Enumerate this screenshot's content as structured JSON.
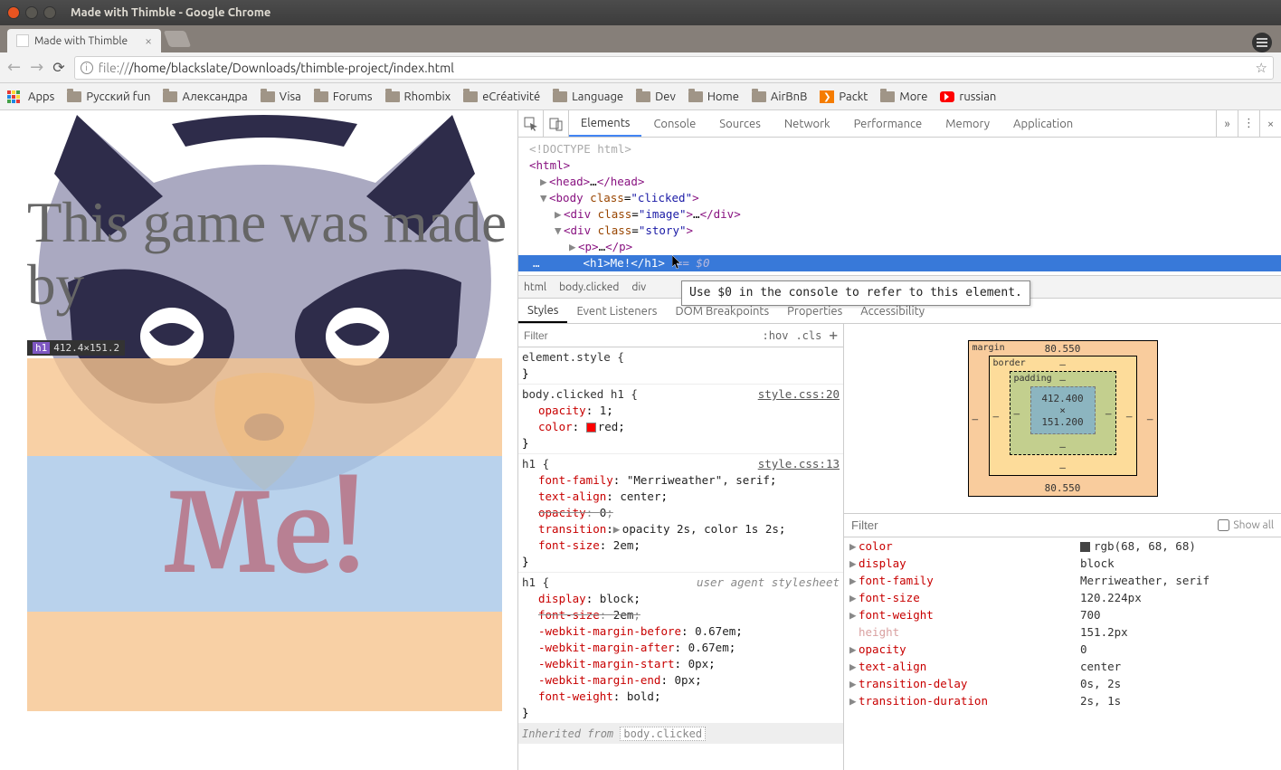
{
  "window": {
    "title": "Made with Thimble - Google Chrome"
  },
  "tab": {
    "title": "Made with Thimble"
  },
  "url": {
    "protocol": "file://",
    "path": "/home/blackslate/Downloads/thimble-project/index.html"
  },
  "bookmarks": {
    "apps": "Apps",
    "items": [
      "Русский fun",
      "Александра",
      "Visa",
      "Forums",
      "Rhombix",
      "eCréativité",
      "Language",
      "Dev",
      "Home",
      "AirBnB"
    ],
    "packt": "Packt",
    "more": "More",
    "russian": "russian"
  },
  "page": {
    "intro": "This game was made by",
    "me": "Me!",
    "dim_badge": {
      "tag": "h1",
      "dims": "412.4×151.2"
    }
  },
  "devtools": {
    "tabs": [
      "Elements",
      "Console",
      "Sources",
      "Network",
      "Performance",
      "Memory",
      "Application"
    ],
    "dom": {
      "doctype": "<!DOCTYPE html>",
      "html_open": "<html>",
      "head": "<head>…</head>",
      "body_open": "body",
      "body_class": "clicked",
      "div_image": "image",
      "div_story": "story",
      "p": "<p>…</p>",
      "h1_open": "<h1>",
      "h1_text": "Me!",
      "h1_close": "</h1>",
      "eq0": "== $0"
    },
    "tooltip": "Use $0 in the console to refer to this element.",
    "crumbs": [
      "html",
      "body.clicked",
      "div"
    ],
    "subtabs": [
      "Styles",
      "Event Listeners",
      "DOM Breakpoints",
      "Properties",
      "Accessibility"
    ],
    "filter_placeholder": "Filter",
    "hov": ":hov",
    "cls": ".cls",
    "rules": {
      "element_style": "element.style {",
      "r1_sel": "body.clicked h1 {",
      "r1_link": "style.css:20",
      "r1_p1n": "opacity",
      "r1_p1v": "1",
      "r1_p2n": "color",
      "r1_p2v": "red",
      "r2_sel": "h1 {",
      "r2_link": "style.css:13",
      "r2_p1n": "font-family",
      "r2_p1v": "\"Merriweather\", serif",
      "r2_p2n": "text-align",
      "r2_p2v": "center",
      "r2_p3n": "opacity",
      "r2_p3v": "0",
      "r2_p4n": "transition",
      "r2_p4v": "opacity 2s, color 1s 2s",
      "r2_p5n": "font-size",
      "r2_p5v": "2em",
      "r3_sel": "h1 {",
      "r3_label": "user agent stylesheet",
      "r3_p1n": "display",
      "r3_p1v": "block",
      "r3_p2n": "font-size",
      "r3_p2v": "2em",
      "r3_p3n": "-webkit-margin-before",
      "r3_p3v": "0.67em",
      "r3_p4n": "-webkit-margin-after",
      "r3_p4v": "0.67em",
      "r3_p5n": "-webkit-margin-start",
      "r3_p5v": "0px",
      "r3_p6n": "-webkit-margin-end",
      "r3_p6v": "0px",
      "r3_p7n": "font-weight",
      "r3_p7v": "bold",
      "inherited": "Inherited from ",
      "inherited_sel": "body.clicked"
    },
    "boxmodel": {
      "margin": "margin",
      "margin_t": "80.550",
      "margin_b": "80.550",
      "border": "border",
      "padding": "padding",
      "content": "412.400 × 151.200",
      "dash": "–"
    },
    "computed_filter": "Filter",
    "showall": "Show all",
    "computed": [
      {
        "n": "color",
        "v": "rgb(68, 68, 68)",
        "sw": true,
        "tw": true
      },
      {
        "n": "display",
        "v": "block",
        "tw": true
      },
      {
        "n": "font-family",
        "v": "Merriweather, serif",
        "tw": true
      },
      {
        "n": "font-size",
        "v": "120.224px",
        "tw": true
      },
      {
        "n": "font-weight",
        "v": "700",
        "tw": true
      },
      {
        "n": "height",
        "v": "151.2px",
        "dim": true
      },
      {
        "n": "opacity",
        "v": "0",
        "tw": true
      },
      {
        "n": "text-align",
        "v": "center",
        "tw": true
      },
      {
        "n": "transition-delay",
        "v": "0s, 2s",
        "tw": true
      },
      {
        "n": "transition-duration",
        "v": "2s, 1s",
        "tw": true
      }
    ]
  }
}
